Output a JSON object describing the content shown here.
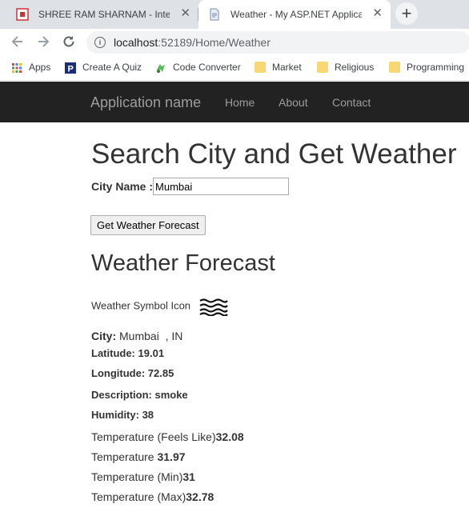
{
  "browser": {
    "tabs": [
      {
        "title": "SHREE RAM SHARNAM - International"
      },
      {
        "title": "Weather - My ASP.NET Application"
      }
    ],
    "new_tab": "+",
    "close_glyph": "✕",
    "address": {
      "host": "localhost",
      "path": ":52189/Home/Weather"
    },
    "bookmarks": [
      {
        "label": "Apps",
        "icon": "apps-grid-icon"
      },
      {
        "label": "Create A Quiz",
        "icon": "p-logo-icon"
      },
      {
        "label": "Code Converter",
        "icon": "converter-icon"
      },
      {
        "label": "Market",
        "icon": "folder-icon"
      },
      {
        "label": "Religious",
        "icon": "folder-icon"
      },
      {
        "label": "Programming",
        "icon": "folder-icon"
      }
    ]
  },
  "navbar": {
    "brand": "Application name",
    "links": [
      "Home",
      "About",
      "Contact"
    ]
  },
  "search": {
    "heading": "Search City and Get Weather",
    "city_label": "City Name :",
    "city_value": "Mumbai",
    "submit_label": "Get Weather Forecast"
  },
  "forecast": {
    "heading": "Weather Forecast",
    "symbol_label": "Weather Symbol Icon",
    "symbol_icon": "smoke-haze-icon",
    "city_label": "City:",
    "city_value": "Mumbai  , IN",
    "latitude_label": "Latitude:",
    "latitude_value": "19.01",
    "longitude_label": "Longitude:",
    "longitude_value": "72.85",
    "description_label": "Description:",
    "description_value": "smoke",
    "humidity_label": "Humidity:",
    "humidity_value": "38",
    "feels_like_label": "Temperature (Feels Like)",
    "feels_like_value": "32.08",
    "temp_label": "Temperature ",
    "temp_value": "31.97",
    "temp_min_label": "Temperature (Min)",
    "temp_min_value": "31",
    "temp_max_label": "Temperature (Max)",
    "temp_max_value": "32.78"
  }
}
